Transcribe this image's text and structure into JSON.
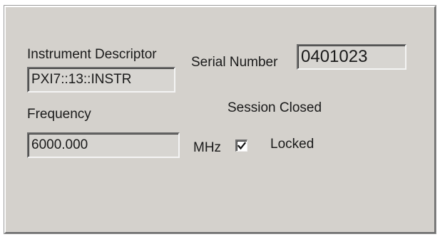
{
  "instrument": {
    "descriptor_label": "Instrument Descriptor",
    "descriptor_value": "PXI7::13::INSTR"
  },
  "serial": {
    "label": "Serial Number",
    "value": "0401023"
  },
  "session": {
    "status": "Session Closed"
  },
  "frequency": {
    "label": "Frequency",
    "value": "6000.000",
    "unit": "MHz"
  },
  "lock": {
    "label": "Locked",
    "checked": true
  }
}
